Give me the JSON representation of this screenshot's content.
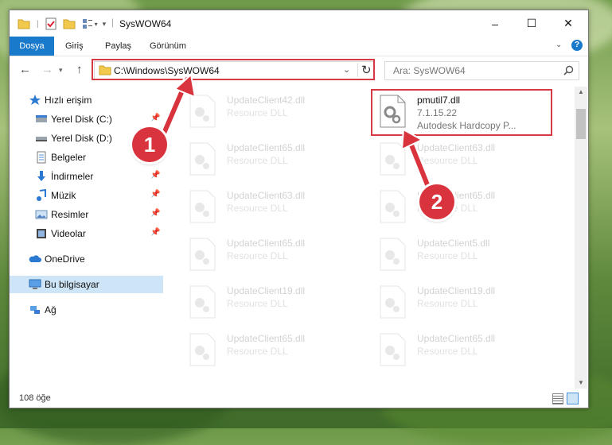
{
  "window": {
    "title": "SysWOW64",
    "controls": {
      "minimize": "–",
      "maximize": "☐",
      "close": "✕"
    }
  },
  "ribbon": {
    "tabs": [
      "Dosya",
      "Giriş",
      "Paylaş",
      "Görünüm"
    ],
    "help_icon": "?"
  },
  "navigation": {
    "address": "C:\\Windows\\SysWOW64",
    "search_placeholder": "Ara: SysWOW64"
  },
  "sidebar": {
    "items": [
      {
        "label": "Hızlı erişim",
        "icon": "star-icon",
        "pinned": false
      },
      {
        "label": "Yerel Disk (C:)",
        "icon": "drive-icon",
        "pinned": true
      },
      {
        "label": "Yerel Disk (D:)",
        "icon": "drive-icon",
        "pinned": true
      },
      {
        "label": "Belgeler",
        "icon": "documents-icon",
        "pinned": true
      },
      {
        "label": "İndirmeler",
        "icon": "download-icon",
        "pinned": true
      },
      {
        "label": "Müzik",
        "icon": "music-icon",
        "pinned": true
      },
      {
        "label": "Resimler",
        "icon": "pictures-icon",
        "pinned": true
      },
      {
        "label": "Videolar",
        "icon": "videos-icon",
        "pinned": true
      },
      {
        "label": "OneDrive",
        "icon": "cloud-icon",
        "pinned": false
      },
      {
        "label": "Bu bilgisayar",
        "icon": "computer-icon",
        "pinned": false,
        "selected": true
      },
      {
        "label": "Ağ",
        "icon": "network-icon",
        "pinned": false
      }
    ]
  },
  "files": {
    "highlighted": {
      "name": "pmutil7.dll",
      "version": "7.1.15.22",
      "description": "Autodesk Hardcopy P..."
    },
    "left_column": [
      {
        "name": "UpdateClient42.dll",
        "type": "Resource DLL"
      },
      {
        "name": "UpdateClient65.dll",
        "type": "Resource DLL"
      },
      {
        "name": "UpdateClient63.dll",
        "type": "Resource DLL"
      },
      {
        "name": "UpdateClient65.dll",
        "type": "Resource DLL"
      },
      {
        "name": "UpdateClient19.dll",
        "type": "Resource DLL"
      },
      {
        "name": "UpdateClient65.dll",
        "type": "Resource DLL"
      }
    ],
    "right_column": [
      {
        "name": "UpdateClient63.dll",
        "type": "Resource DLL"
      },
      {
        "name": "UpdateClient65.dll",
        "type": "Resource DLL"
      },
      {
        "name": "UpdateClient5.dll",
        "type": "Resource DLL"
      },
      {
        "name": "UpdateClient19.dll",
        "type": "Resource DLL"
      },
      {
        "name": "UpdateClient65.dll",
        "type": "Resource DLL"
      }
    ]
  },
  "status": {
    "item_count": "108 öğe"
  },
  "annotations": {
    "marker_1": "1",
    "marker_2": "2",
    "highlight_color": "#d83a45"
  }
}
